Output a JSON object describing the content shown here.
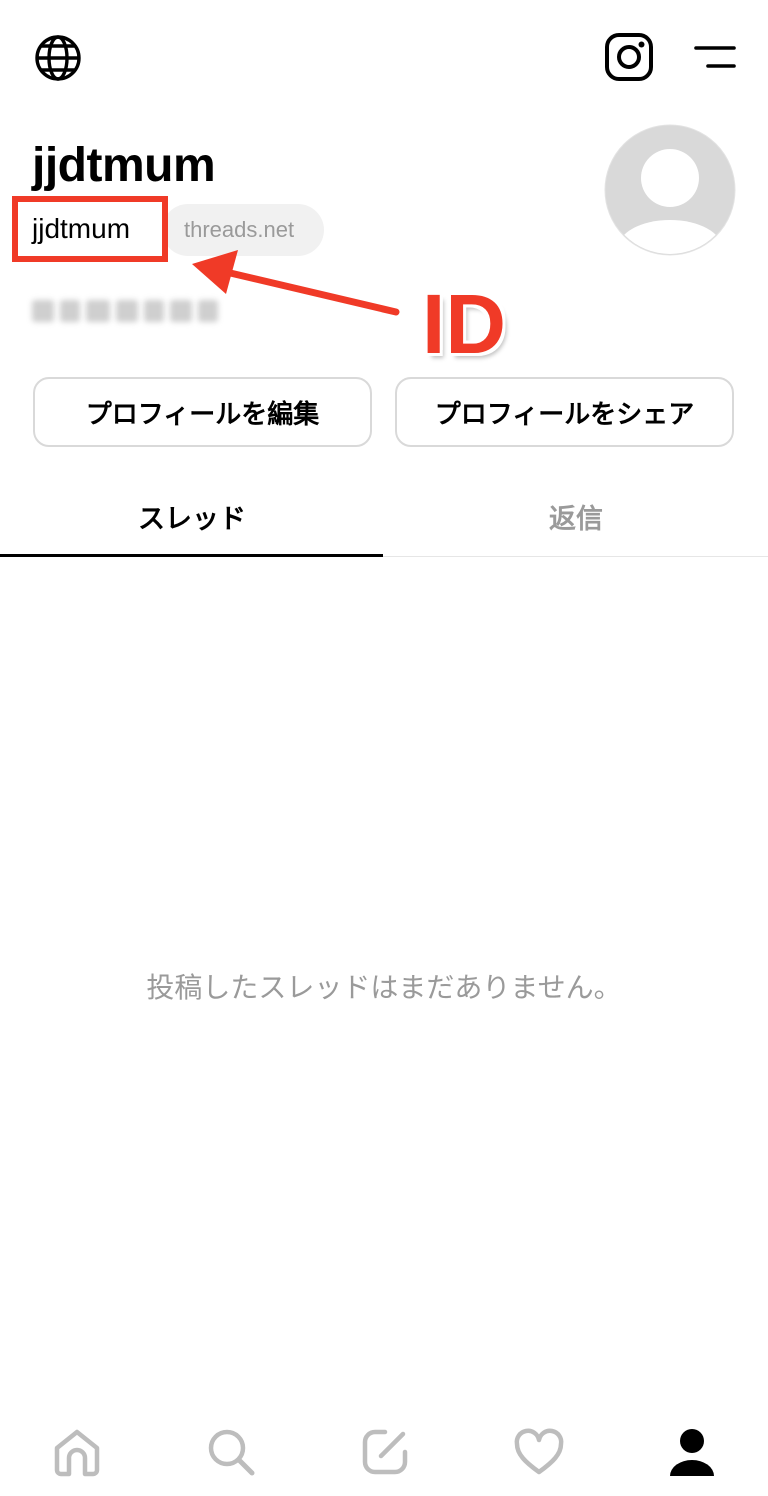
{
  "header": {
    "globe_icon": "globe-icon",
    "instagram_icon": "instagram-icon",
    "menu_icon": "menu-icon"
  },
  "profile": {
    "display_name": "jjdtmum",
    "username": "jjdtmum",
    "domain": "threads.net",
    "avatar_icon": "default-avatar-icon"
  },
  "annotation": {
    "label": "ID",
    "color": "#f03a27"
  },
  "actions": {
    "edit_label": "プロフィールを編集",
    "share_label": "プロフィールをシェア"
  },
  "tabs": [
    {
      "label": "スレッド",
      "active": true
    },
    {
      "label": "返信",
      "active": false
    }
  ],
  "empty_state": "投稿したスレッドはまだありません。",
  "bottom_nav": [
    {
      "icon": "home-icon",
      "active": false
    },
    {
      "icon": "search-icon",
      "active": false
    },
    {
      "icon": "compose-icon",
      "active": false
    },
    {
      "icon": "heart-icon",
      "active": false
    },
    {
      "icon": "profile-icon",
      "active": true
    }
  ]
}
